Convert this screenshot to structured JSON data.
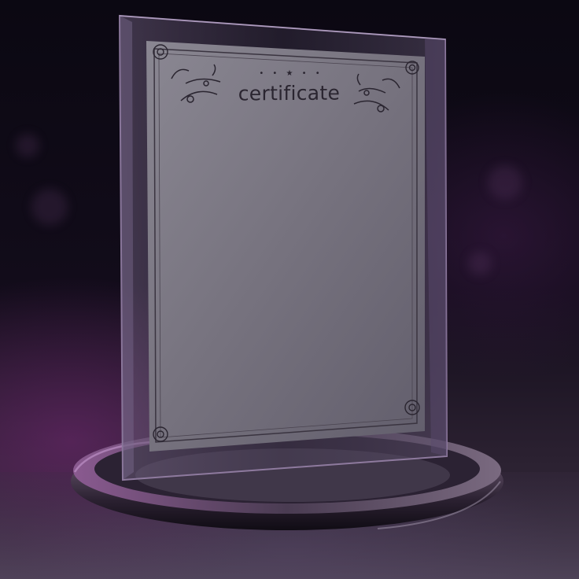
{
  "scene": {
    "description_label": "certificate-plaque",
    "colors": {
      "background": "#0d0a14",
      "accent_glow": "#8a2f8a",
      "paper": "#7d7a85",
      "ornament": "#2a2530",
      "base_ring": "#6b5a6e"
    }
  },
  "certificate": {
    "title": "certificate",
    "star_ornament": "• • ★ • •"
  }
}
